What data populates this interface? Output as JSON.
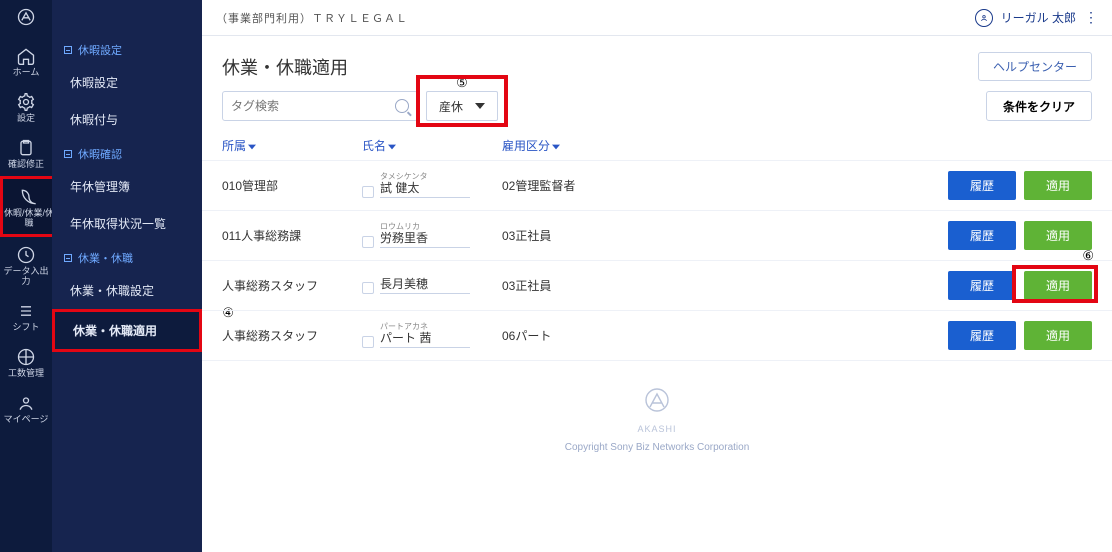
{
  "brand": "AKASHI",
  "rail": [
    {
      "label": "ホーム"
    },
    {
      "label": "設定"
    },
    {
      "label": "確認修正"
    },
    {
      "label": "休暇/休業/休職"
    },
    {
      "label": "データ入出力"
    },
    {
      "label": "シフト"
    },
    {
      "label": "工数管理"
    },
    {
      "label": "マイページ"
    }
  ],
  "side": {
    "g1": {
      "title": "休暇設定",
      "items": [
        "休暇設定",
        "休暇付与"
      ]
    },
    "g2": {
      "title": "休暇確認",
      "items": [
        "年休管理簿",
        "年休取得状況一覧"
      ]
    },
    "g3": {
      "title": "休業・休職",
      "items": [
        "休業・休職設定",
        "休業・休職適用"
      ]
    }
  },
  "step4": "④",
  "step5": "⑤",
  "step6": "⑥",
  "header": {
    "org": "（事業部門利用）ＴＲＹＬＥＧＡＬ",
    "user": "リーガル 太郎"
  },
  "page_title": "休業・休職適用",
  "help": "ヘルプセンター",
  "search_ph": "タグ検索",
  "dd_value": "産休",
  "clear": "条件をクリア",
  "cols": {
    "dept": "所属",
    "name": "氏名",
    "emp": "雇用区分"
  },
  "btn": {
    "hist": "履歴",
    "apply": "適用"
  },
  "rows": [
    {
      "dept": "010管理部",
      "furi": "タメシケンタ",
      "name": "試 健太",
      "emp": "02管理監督者"
    },
    {
      "dept": "011人事総務課",
      "furi": "ロウムリカ",
      "name": "労務里香",
      "emp": "03正社員"
    },
    {
      "dept": "人事総務スタッフ",
      "furi": "",
      "name": "長月美穂",
      "emp": "03正社員",
      "hi": true
    },
    {
      "dept": "人事総務スタッフ",
      "furi": "パートアカネ",
      "name": "パート 茜",
      "emp": "06パート"
    }
  ],
  "footer_name": "AKASHI",
  "copyright": "Copyright Sony Biz Networks Corporation"
}
